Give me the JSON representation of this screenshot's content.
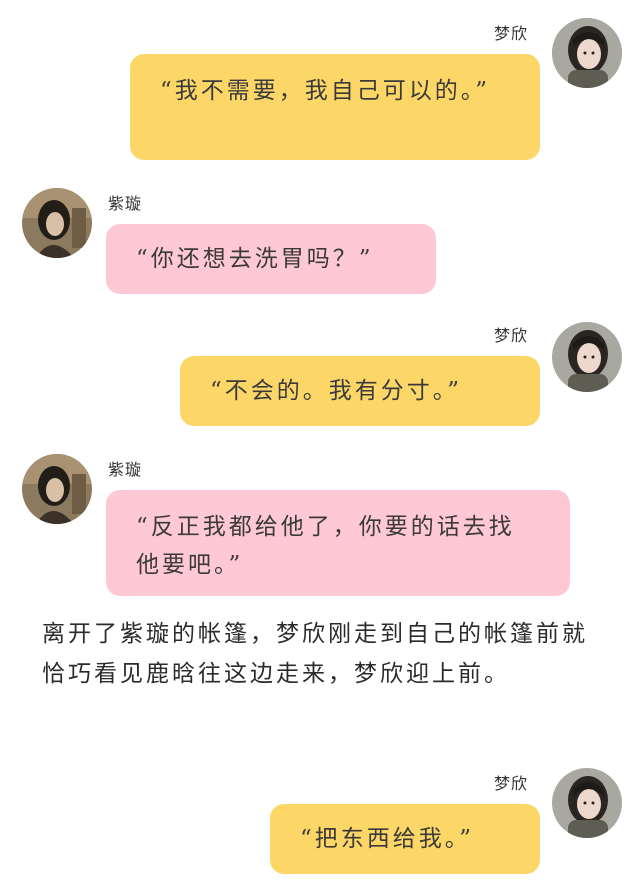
{
  "colors": {
    "right_bubble": "#fcd767",
    "left_bubble": "#fec8d4",
    "background": "#ffffff"
  },
  "icons": {
    "right_avatar": "girl-portrait-avatar",
    "left_avatar": "girl-sitting-avatar"
  },
  "messages": [
    {
      "side": "right",
      "speaker": "梦欣",
      "text": "“我不需要，我自己可以的。”"
    },
    {
      "side": "left",
      "speaker": "紫璇",
      "text": "“你还想去洗胃吗？”"
    },
    {
      "side": "right",
      "speaker": "梦欣",
      "text": "“不会的。我有分寸。”"
    },
    {
      "side": "left",
      "speaker": "紫璇",
      "text": "“反正我都给他了，你要的话去找他要吧。”"
    },
    {
      "side": "right",
      "speaker": "梦欣",
      "text": "“把东西给我。”"
    }
  ],
  "narration": "离开了紫璇的帐篷，梦欣刚走到自己的帐篷前就恰巧看见鹿晗往这边走来，梦欣迎上前。"
}
